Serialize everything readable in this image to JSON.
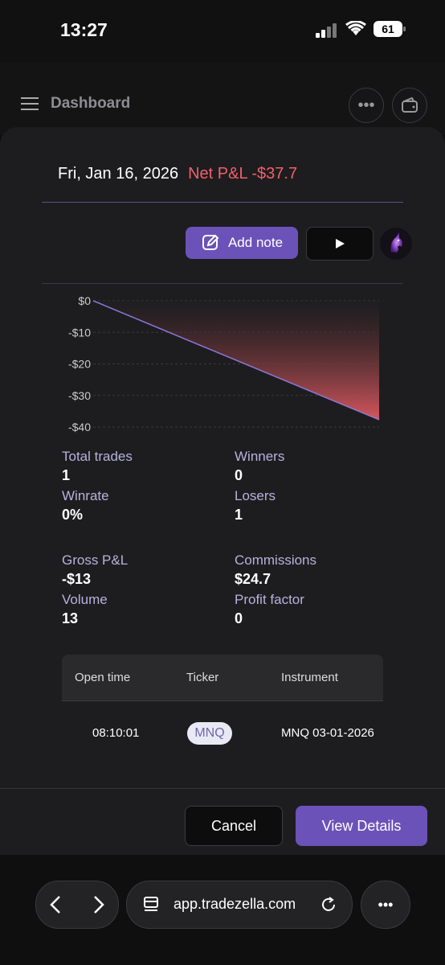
{
  "status_bar": {
    "time": "13:27",
    "battery": "61"
  },
  "header": {
    "title": "Dashboard"
  },
  "modal": {
    "date": "Fri, Jan 16, 2026",
    "net_pl": "Net P&L -$37.7",
    "add_note_label": "Add note"
  },
  "chart_data": {
    "type": "area",
    "x": [
      0,
      1
    ],
    "values": [
      0,
      -37.7
    ],
    "tick_labels": [
      "$0",
      "-$10",
      "-$20",
      "-$30",
      "-$40"
    ],
    "ylim": [
      -40,
      0
    ],
    "grid": true,
    "colors": {
      "line": "#8a78d8",
      "fill": "#e05a60"
    }
  },
  "stats": {
    "total_trades_label": "Total trades",
    "total_trades": "1",
    "winners_label": "Winners",
    "winners": "0",
    "winrate_label": "Winrate",
    "winrate": "0%",
    "losers_label": "Losers",
    "losers": "1",
    "gross_pl_label": "Gross P&L",
    "gross_pl": "-$13",
    "commissions_label": "Commissions",
    "commissions": "$24.7",
    "volume_label": "Volume",
    "volume": "13",
    "profit_factor_label": "Profit factor",
    "profit_factor": "0"
  },
  "table": {
    "headers": [
      "Open time",
      "Ticker",
      "Instrument"
    ],
    "rows": [
      {
        "open_time": "08:10:01",
        "ticker": "MNQ",
        "instrument": "MNQ 03-01-2026"
      }
    ]
  },
  "footer": {
    "cancel_label": "Cancel",
    "view_details_label": "View Details"
  },
  "browser": {
    "url": "app.tradezella.com"
  },
  "colors": {
    "accent": "#6b52b8",
    "loss": "#f0606a"
  }
}
